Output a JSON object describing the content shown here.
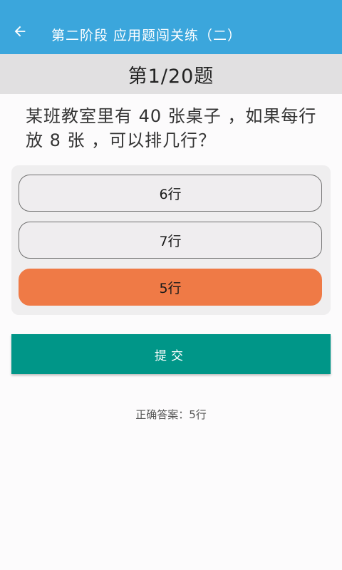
{
  "appbar": {
    "back_icon": "arrow-left-icon",
    "title": "第二阶段 应用题闯关练（二）",
    "background": "#3ba6dc"
  },
  "progress": {
    "label": "第1/20题"
  },
  "question": {
    "text": "某班教室里有 40 张桌子 ，如果每行放 8 张 ，可以排几行？"
  },
  "options": [
    {
      "label": "6行",
      "selected": false
    },
    {
      "label": "7行",
      "selected": false
    },
    {
      "label": "5行",
      "selected": true
    }
  ],
  "submit": {
    "label": "提交",
    "color": "#009688"
  },
  "answer": {
    "text": "正确答案：5行"
  },
  "colors": {
    "selected_option": "#ef7a46",
    "band": "#e1e0e1"
  }
}
